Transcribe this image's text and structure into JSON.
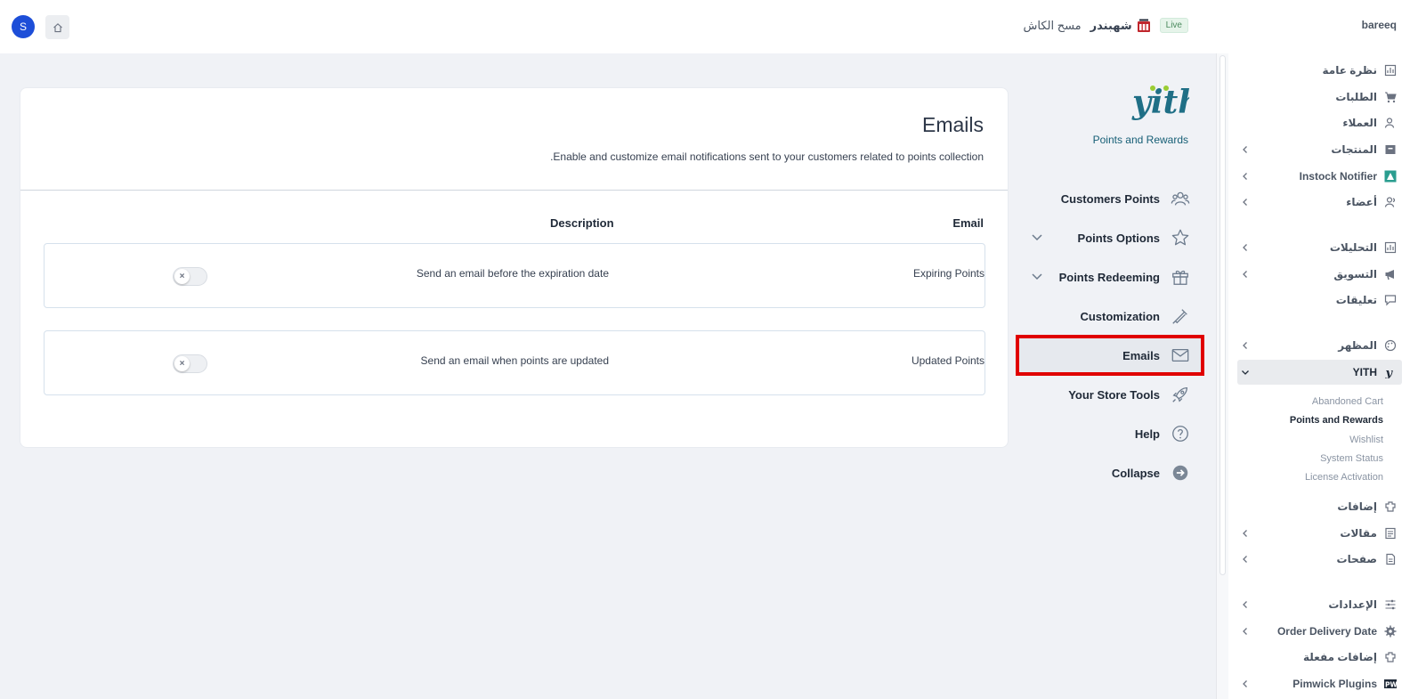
{
  "topbar": {
    "avatar_letter": "S",
    "live_badge": "Live",
    "brand": "شهبندر",
    "clear_cache": "مسح الكاش",
    "store_name": "bareeq"
  },
  "card": {
    "title": "Emails",
    "description": ".Enable and customize email notifications sent to your customers related to points collection",
    "col_email": "Email",
    "col_description": "Description",
    "rows": [
      {
        "name": "Expiring Points",
        "description": "Send an email before the expiration date",
        "enabled": false,
        "toggle_glyph": "×"
      },
      {
        "name": "Updated Points",
        "description": "Send an email when points are updated",
        "enabled": false,
        "toggle_glyph": "×"
      }
    ]
  },
  "plugin": {
    "subtitle": "Points and Rewards",
    "nav": [
      {
        "label": "Customers Points",
        "icon": "users-icon"
      },
      {
        "label": "Points Options",
        "icon": "star-icon",
        "expandable": true
      },
      {
        "label": "Points Redeeming",
        "icon": "gift-icon",
        "expandable": true
      },
      {
        "label": "Customization",
        "icon": "eyedropper-icon"
      },
      {
        "label": "Emails",
        "icon": "envelope-icon",
        "active": true
      },
      {
        "label": "Your Store Tools",
        "icon": "rocket-icon"
      },
      {
        "label": "Help",
        "icon": "question-icon"
      },
      {
        "label": "Collapse",
        "icon": "arrow-circle-icon"
      }
    ]
  },
  "sidebar": {
    "items": [
      {
        "label": "نظرة عامة",
        "icon": "dashboard-icon"
      },
      {
        "label": "الطلبات",
        "icon": "cart-icon"
      },
      {
        "label": "العملاء",
        "icon": "customers-icon"
      },
      {
        "label": "المنتجات",
        "icon": "box-icon",
        "expandable": true
      },
      {
        "label": "Instock Notifier",
        "icon": "notifier-icon",
        "expandable": true
      },
      {
        "label": "أعضاء",
        "icon": "members-icon",
        "expandable": true
      },
      {
        "label": "التحليلات",
        "icon": "analytics-icon",
        "expandable": true
      },
      {
        "label": "التسويق",
        "icon": "megaphone-icon",
        "expandable": true
      },
      {
        "label": "تعليقات",
        "icon": "comments-icon"
      },
      {
        "label": "المظهر",
        "icon": "palette-icon",
        "expandable": true
      },
      {
        "label": "YITH",
        "icon": "yith-icon",
        "expandable": true,
        "active": true
      },
      {
        "label": "إضافات",
        "icon": "plugins-icon"
      },
      {
        "label": "مقالات",
        "icon": "posts-icon",
        "expandable": true
      },
      {
        "label": "صفحات",
        "icon": "pages-icon",
        "expandable": true
      },
      {
        "label": "الإعدادات",
        "icon": "settings-icon",
        "expandable": true
      },
      {
        "label": "Order Delivery Date",
        "icon": "gear-icon",
        "expandable": true
      },
      {
        "label": "إضافات مفعلة",
        "icon": "plugins-active-icon"
      },
      {
        "label": "Pimwick Plugins",
        "icon": "pw-icon",
        "expandable": true
      }
    ],
    "yith_subitems": [
      "Abandoned Cart",
      "Points and Rewards",
      "Wishlist",
      "System Status",
      "License Activation"
    ]
  }
}
